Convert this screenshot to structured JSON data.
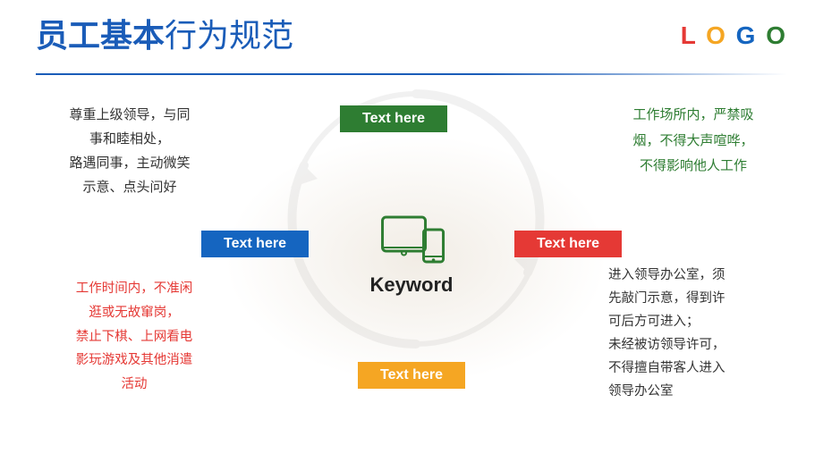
{
  "header": {
    "title_part1": "员工基本",
    "title_part2": "行为规范",
    "logo": {
      "l": "L",
      "o1": "O",
      "g": "G",
      "o2": "O"
    }
  },
  "tags": {
    "top_center": "Text here",
    "mid_left": "Text here",
    "mid_right": "Text here",
    "bottom_center": "Text here"
  },
  "center": {
    "keyword": "Keyword"
  },
  "left_top": {
    "text": "尊重上级领导，与同\n事和睦相处，\n路遇同事，主动微笑\n示意、点头问好"
  },
  "right_top": {
    "text": "工作场所内，严禁吸\n烟，不得大声喧哗，\n不得影响他人工作"
  },
  "left_bottom": {
    "text": "工作时间内，不准闲\n逛或无故窜岗，\n禁止下棋、上网看电\n影玩游戏及其他消遣\n活动"
  },
  "right_bottom": {
    "text": "进入领导办公室，须\n先敲门示意，得到许\n可后方可进入；\n未经被访领导许可，\n不得擅自带客人进入\n领导办公室"
  }
}
